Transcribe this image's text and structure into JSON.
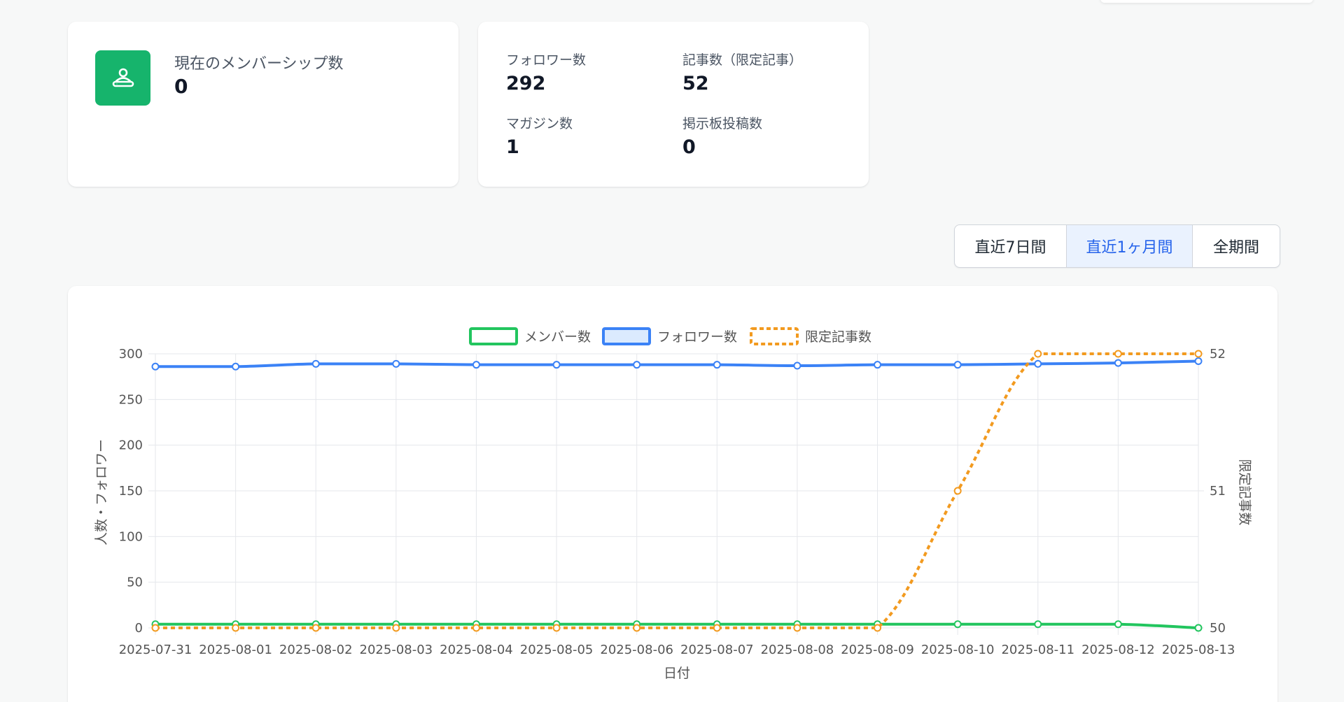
{
  "member_card": {
    "label": "現在のメンバーシップ数",
    "value": "0",
    "icon": "members-icon",
    "icon_bg": "#16b46c"
  },
  "stats_card": {
    "items": [
      {
        "label": "フォロワー数",
        "value": "292"
      },
      {
        "label": "記事数（限定記事）",
        "value": "52"
      },
      {
        "label": "マガジン数",
        "value": "1"
      },
      {
        "label": "掲示板投稿数",
        "value": "0"
      }
    ]
  },
  "range_buttons": [
    {
      "label": "直近7日間",
      "active": false
    },
    {
      "label": "直近1ヶ月間",
      "active": true
    },
    {
      "label": "全期間",
      "active": false
    }
  ],
  "colors": {
    "members": "#22c55e",
    "followers": "#3b82f6",
    "limited": "#f29a1f",
    "active_bg": "#eaf2fe",
    "active_text": "#2563eb"
  },
  "chart_data": {
    "type": "line",
    "x": [
      "2025-07-31",
      "2025-08-01",
      "2025-08-02",
      "2025-08-03",
      "2025-08-04",
      "2025-08-05",
      "2025-08-06",
      "2025-08-07",
      "2025-08-08",
      "2025-08-09",
      "2025-08-10",
      "2025-08-11",
      "2025-08-12",
      "2025-08-13"
    ],
    "xlabel": "日付",
    "ylabel": "人数・フォロワー",
    "y2label": "限定記事数",
    "ylim": [
      0,
      300
    ],
    "y2lim": [
      50,
      52
    ],
    "yticks": [
      0,
      50,
      100,
      150,
      200,
      250,
      300
    ],
    "y2ticks": [
      50,
      51,
      52
    ],
    "grid": true,
    "legend_position": "top-center",
    "series": [
      {
        "name": "メンバー数",
        "axis": "left",
        "style": "solid",
        "values": [
          4,
          4,
          4,
          4,
          4,
          4,
          4,
          4,
          4,
          4,
          4,
          4,
          4,
          0
        ]
      },
      {
        "name": "フォロワー数",
        "axis": "left",
        "style": "solid",
        "values": [
          286,
          286,
          289,
          289,
          288,
          288,
          288,
          288,
          287,
          288,
          288,
          289,
          290,
          292
        ]
      },
      {
        "name": "限定記事数",
        "axis": "right",
        "style": "dashed",
        "values": [
          50,
          50,
          50,
          50,
          50,
          50,
          50,
          50,
          50,
          50,
          51,
          52,
          52,
          52
        ]
      }
    ]
  }
}
